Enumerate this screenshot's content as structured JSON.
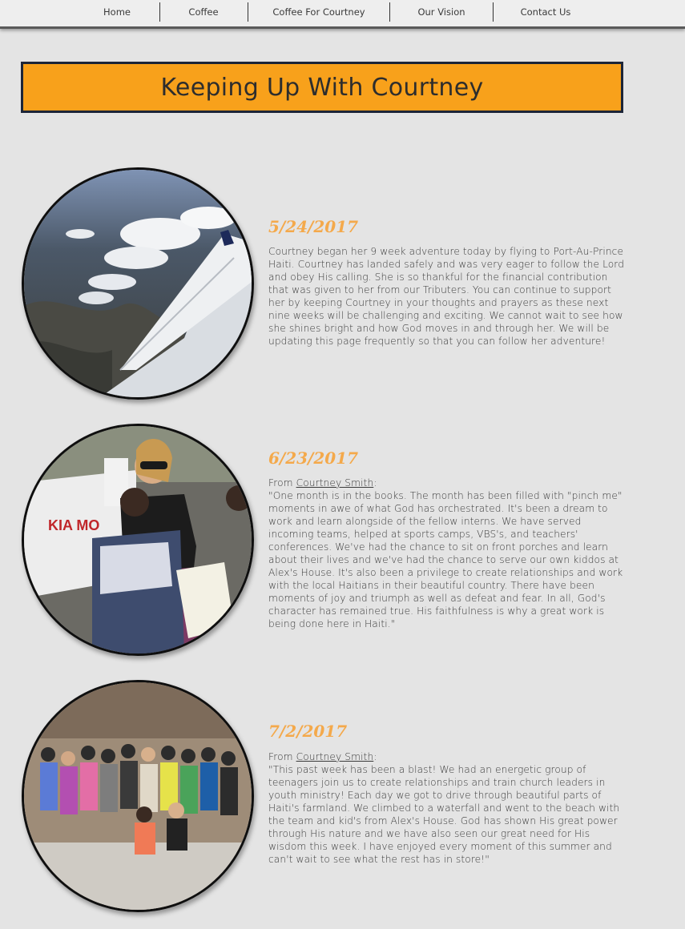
{
  "nav": {
    "items": [
      {
        "label": "Home"
      },
      {
        "label": "Coffee"
      },
      {
        "label": "Coffee For Courtney"
      },
      {
        "label": "Our Vision"
      },
      {
        "label": "Contact Us"
      }
    ]
  },
  "page_title": "Keeping Up With Courtney",
  "posts": [
    {
      "date": "5/24/2017",
      "body": "Courtney began her 9 week adventure today by flying to Port-Au-Prince Haiti. Courtney has landed safely and was very eager to follow the Lord and obey His calling. She is so thankful for the financial contribution that was given to her from our Tributers. You can continue to support her by keeping Courtney in your thoughts and prayers as these next nine weeks will be challenging and exciting. We cannot wait to see how she shines bright and how God moves in and through her. We will be updating this page frequently so that you can follow her adventure!"
    },
    {
      "date": "6/23/2017",
      "from_prefix": "From ",
      "from_name": "Courtney Smith",
      "from_suffix": ":",
      "body": "\"One month is in the books. The month has been filled with \"pinch me\" moments in awe of what God has orchestrated. It's been a dream to work and learn alongside of the fellow interns. We have served incoming teams, helped at sports camps, VBS's, and teachers' conferences. We've had the chance to sit on front porches and learn about their lives and we've had the chance to serve our own kiddos at Alex's House. It's also been a privilege to create relationships and work with the local Haitians in their beautiful country. There have been moments of joy and triumph as well as defeat and fear. In all, God's character has remained true. His faithfulness is why a great work is being done here in Haiti.\""
    },
    {
      "date": "7/2/2017",
      "from_prefix": "From ",
      "from_name": "Courtney Smith",
      "from_suffix": ":",
      "body": "\"This past week has been a blast! We had an energetic group of teenagers join us to create relationships and train church leaders in youth ministry! Each day we got to drive through beautiful parts of Haiti's farmland. We climbed to a waterfall and went to the beach with the team and kid's from Alex's House. God has shown His great power through His nature and we have also seen our great need for His wisdom this week. I have enjoyed every moment of this summer and can't wait to see what the rest has in store!\""
    }
  ],
  "colors": {
    "accent_orange": "#f8a11b",
    "date_orange": "#f4a94b",
    "navy_border": "#1c2538",
    "background": "#e4e4e4"
  }
}
